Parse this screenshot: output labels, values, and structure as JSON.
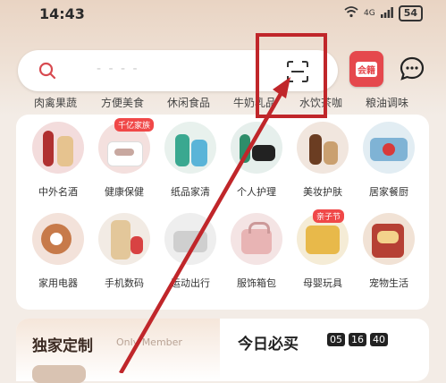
{
  "status": {
    "time": "14:43",
    "network": "4G",
    "battery": "54"
  },
  "search": {
    "placeholder": "- - - -"
  },
  "header": {
    "vip_label": "会籍"
  },
  "tabs": [
    {
      "label": "肉禽果蔬"
    },
    {
      "label": "方便美食"
    },
    {
      "label": "休闲食品"
    },
    {
      "label": "牛奶乳品"
    },
    {
      "label": "水饮茶咖"
    },
    {
      "label": "粮油调味"
    }
  ],
  "categories_row1": [
    {
      "label": "中外名酒",
      "badge": ""
    },
    {
      "label": "健康保健",
      "badge": "千亿家族"
    },
    {
      "label": "纸品家清",
      "badge": ""
    },
    {
      "label": "个人护理",
      "badge": ""
    },
    {
      "label": "美妆护肤",
      "badge": ""
    },
    {
      "label": "居家餐厨",
      "badge": ""
    }
  ],
  "categories_row2": [
    {
      "label": "家用电器",
      "badge": ""
    },
    {
      "label": "手机数码",
      "badge": ""
    },
    {
      "label": "运动出行",
      "badge": ""
    },
    {
      "label": "服饰箱包",
      "badge": ""
    },
    {
      "label": "母婴玩具",
      "badge": "亲子节"
    },
    {
      "label": "宠物生活",
      "badge": ""
    }
  ],
  "exclusive": {
    "title": "独家定制",
    "subtitle": "Only Member"
  },
  "today": {
    "title": "今日必买",
    "timer": [
      "05",
      "16",
      "40"
    ]
  },
  "colors": {
    "accent_red": "#e5484d",
    "annotation": "#c0262a"
  }
}
